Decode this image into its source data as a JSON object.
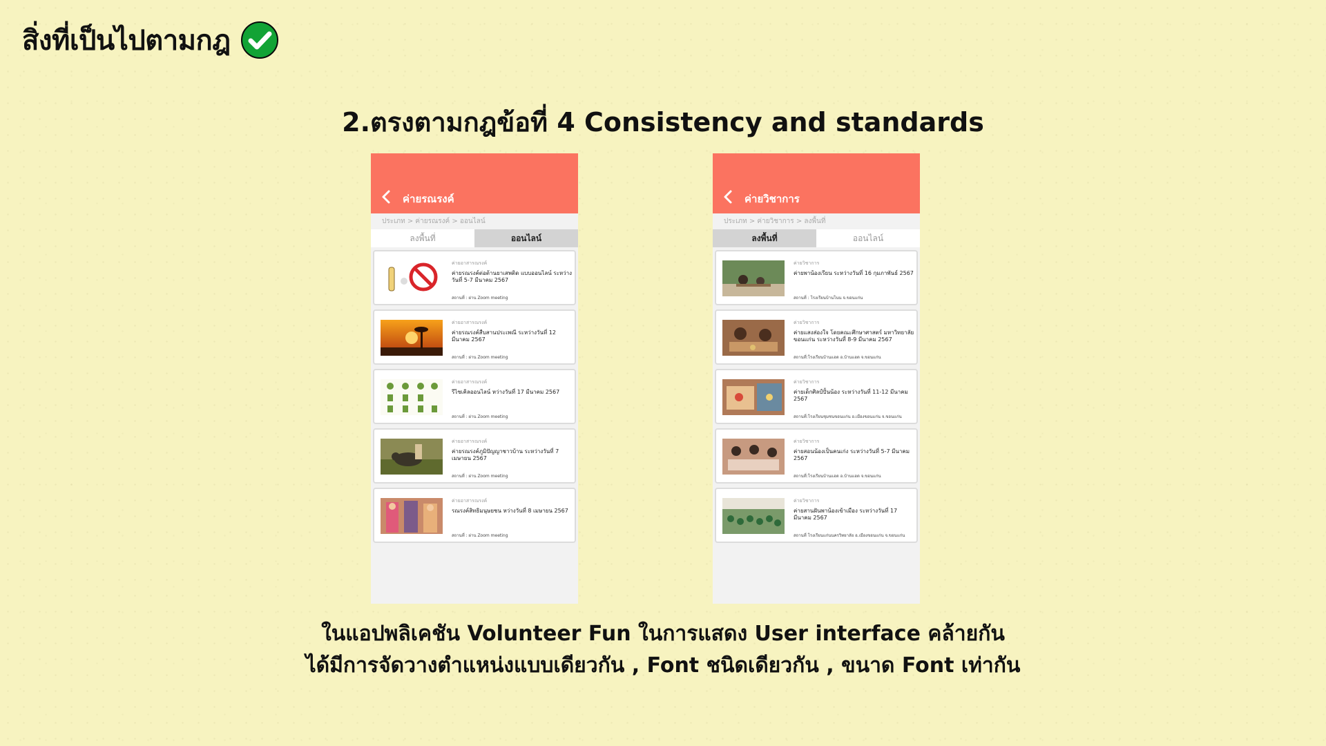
{
  "header": {
    "title": "สิ่งที่เป็นไปตามกฎ",
    "icon": "check-circle-icon",
    "icon_color": "#12a335"
  },
  "slide_title": "2.ตรงตามกฎข้อที่ 4 Consistency and standards",
  "accent_color": "#fb7360",
  "phones": [
    {
      "appbar_title": "ค่ายรณรงค์",
      "breadcrumb": "ประเภท > ค่ายรณรงค์ > ออนไลน์",
      "tabs": [
        "ลงพื้นที่",
        "ออนไลน์"
      ],
      "active_tab": 1,
      "cards": [
        {
          "thumb": "no-smoking-cartoon",
          "category": "ค่ายอาสารณรงค์",
          "title": "ค่ายรณรงค์ต่อต้านยาเสพติด แบบออนไลน์ ระหว่างวันที่ 5-7 มีนาคม 2567",
          "location": "สถานที่ : ผ่าน Zoom meeting"
        },
        {
          "thumb": "sunset-palm",
          "category": "ค่ายอาสารณรงค์",
          "title": "ค่ายรณรงค์สืบสานประเพณี ระหว่างวันที่ 12 มีนาคม 2567",
          "location": "สถานที่ : ผ่าน Zoom meeting"
        },
        {
          "thumb": "recycle-icons",
          "category": "ค่ายอาสารณรงค์",
          "title": "รีไซเคิลออนไลน์ หว่างวันที่ 17 มีนาคม 2567",
          "location": "สถานที่ : ผ่าน Zoom meeting"
        },
        {
          "thumb": "buffalo-field",
          "category": "ค่ายอาสารณรงค์",
          "title": "ค่ายรณรงค์ภูมิปัญญาชาวบ้าน ระหว่างวันที่ 7 เมษายน 2567",
          "location": "สถานที่ : ผ่าน Zoom meeting"
        },
        {
          "thumb": "traditional-art",
          "category": "ค่ายอาสารณรงค์",
          "title": "รณรงค์สิทธิมนุษยชน หว่างวันที่ 8 เมษายน 2567",
          "location": "สถานที่ : ผ่าน Zoom meeting"
        }
      ]
    },
    {
      "appbar_title": "ค่ายวิชาการ",
      "breadcrumb": "ประเภท > ค่ายวิชาการ > ลงพื้นที่",
      "tabs": [
        "ลงพื้นที่",
        "ออนไลน์"
      ],
      "active_tab": 0,
      "cards": [
        {
          "thumb": "kids-outdoor",
          "category": "ค่ายวิชาการ",
          "title": "ค่ายพาน้องเรียน ระหว่างวันที่ 16 กุมภาพันธ์ 2567",
          "location": "สถานที่ : โรงเรียนบ้านโนน จ.ขอนแก่น"
        },
        {
          "thumb": "kids-craft",
          "category": "ค่ายวิชาการ",
          "title": "ค่ายแสงส่องใจ โดยคณะศึกษาศาสตร์ มหาวิทยาลัยขอนแก่น ระหว่างวันที่ 8-9 มีนาคม 2567",
          "location": "สถานที่:โรงเรียนบ้านแฮด อ.บ้านแฮด จ.ขอนแก่น"
        },
        {
          "thumb": "kids-painting",
          "category": "ค่ายวิชาการ",
          "title": "ค่ายเด็กศิลป์ปั้นน้อง ระหว่างวันที่ 11-12 มีนาคม 2567",
          "location": "สถานที่:โรงเรียนชุมชนขอนแก่น อ.เมืองขอนแก่น จ.ขอนแก่น"
        },
        {
          "thumb": "kids-class",
          "category": "ค่ายวิชาการ",
          "title": "ค่ายสอนน้องเป็นคนเก่ง ระหว่างวันที่ 5-7 มีนาคม 2567",
          "location": "สถานที่:โรงเรียนบ้านแฮด อ.บ้านแฮด จ.ขอนแก่น"
        },
        {
          "thumb": "kids-group",
          "category": "ค่ายวิชาการ",
          "title": "ค่ายสานฝันพาน้องเข้าเมือง ระหว่างวันที่ 17 มีนาคม 2567",
          "location": "สถานที่ โรงเรียนแก่นนครวิทยาลัย อ.เมืองขอนแก่น จ.ขอนแก่น"
        }
      ]
    }
  ],
  "caption": {
    "line1": "ในแอปพลิเคชัน Volunteer Fun ในการแสดง User interface คล้ายกัน",
    "line2": "ได้มีการจัดวางตำแหน่งแบบเดียวกัน , Font ชนิดเดียวกัน , ขนาด Font เท่ากัน"
  }
}
